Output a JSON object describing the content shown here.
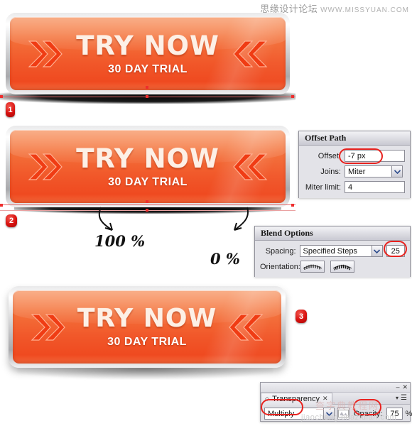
{
  "watermarks": {
    "top_cn": "思缘设计论坛",
    "top_url": "WWW.MISSYUAN.COM",
    "bottom": "jiaocheng.chazidian.com",
    "mid_cn": "查字典教程网"
  },
  "buttons": [
    {
      "id": "button-1",
      "title": "TRY NOW",
      "subtitle": "30 DAY TRIAL"
    },
    {
      "id": "button-2",
      "title": "TRY NOW",
      "subtitle": "30 DAY TRIAL"
    },
    {
      "id": "button-3",
      "title": "TRY NOW",
      "subtitle": "30 DAY TRIAL"
    }
  ],
  "steps": [
    {
      "label": "1"
    },
    {
      "label": "2"
    },
    {
      "label": "3"
    }
  ],
  "annotations": [
    {
      "text": "100 %"
    },
    {
      "text": "0 %"
    }
  ],
  "offset_path_panel": {
    "title": "Offset Path",
    "offset_label": "Offset:",
    "offset_value": "-7 px",
    "joins_label": "Joins:",
    "joins_value": "Miter",
    "miter_label": "Miter limit:",
    "miter_value": "4"
  },
  "blend_options_panel": {
    "title": "Blend Options",
    "spacing_label": "Spacing:",
    "spacing_value": "Specified Steps",
    "steps_value": "25",
    "orientation_label": "Orientation:",
    "orientation_icons": [
      "align-to-page-icon",
      "align-to-path-icon"
    ]
  },
  "transparency_panel": {
    "tab_label": "Transparency",
    "blend_mode": "Multiply",
    "opacity_label": "Opacity:",
    "opacity_value": "75",
    "opacity_unit": "%"
  },
  "colors": {
    "orange_top": "#f78c55",
    "orange_bottom": "#ef4a20",
    "badge_red": "#d8110f",
    "highlight_ring": "#e8221e",
    "guide_red": "#e46a6a"
  }
}
